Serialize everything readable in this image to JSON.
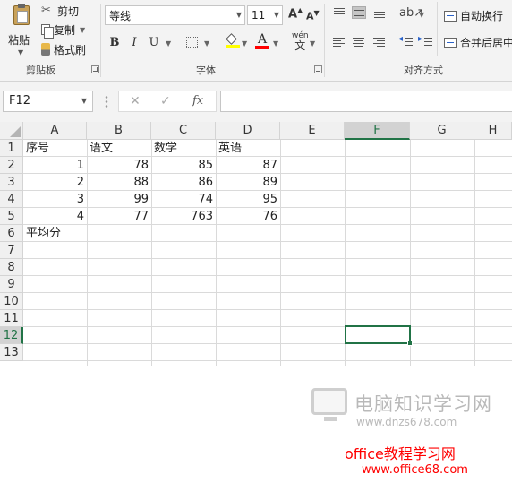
{
  "ribbon": {
    "clipboard": {
      "paste": "粘贴",
      "cut": "剪切",
      "copy": "复制",
      "format_painter": "格式刷",
      "group_label": "剪贴板"
    },
    "font": {
      "font_name": "等线",
      "font_size": "11",
      "bold": "B",
      "italic": "I",
      "underline": "U",
      "font_color_glyph": "A",
      "phonetic_top": "wén",
      "phonetic_bottom": "文",
      "grow_glyph": "A",
      "shrink_glyph": "A",
      "fill_color": "#ffff00",
      "font_color": "#ff0000",
      "group_label": "字体"
    },
    "alignment": {
      "wrap_text": "自动换行",
      "merge_center": "合并后居中",
      "group_label": "对齐方式"
    }
  },
  "formula_bar": {
    "name_box": "F12",
    "cancel": "✕",
    "enter": "✓",
    "fx": "fx",
    "formula": ""
  },
  "sheet": {
    "columns": [
      "A",
      "B",
      "C",
      "D",
      "E",
      "F",
      "G",
      "H"
    ],
    "rows": [
      "1",
      "2",
      "3",
      "4",
      "5",
      "6",
      "7",
      "8",
      "9",
      "10",
      "11",
      "12",
      "13"
    ],
    "active_cell": "F12",
    "cells": {
      "A1": "序号",
      "B1": "语文",
      "C1": "数学",
      "D1": "英语",
      "A2": "1",
      "B2": "78",
      "C2": "85",
      "D2": "87",
      "A3": "2",
      "B3": "88",
      "C3": "86",
      "D3": "89",
      "A4": "3",
      "B4": "99",
      "C4": "74",
      "D4": "95",
      "A5": "4",
      "B5": "77",
      "C5": "763",
      "D5": "76",
      "A6": "平均分"
    }
  },
  "watermarks": {
    "site1_title": "电脑知识学习网",
    "site1_url": "www.dnzs678.com",
    "site2_title": "office教程学习网",
    "site2_url": "www.office68.com"
  }
}
